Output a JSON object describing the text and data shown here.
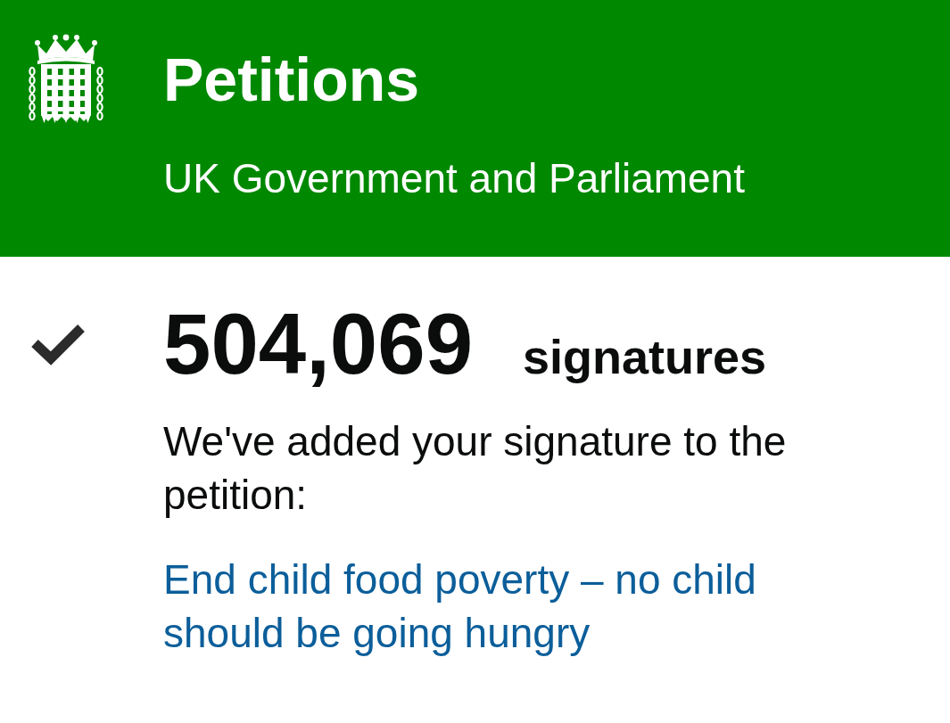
{
  "header": {
    "title": "Petitions",
    "subtitle": "UK Government and Parliament"
  },
  "signature_count": {
    "count": "504,069",
    "unit": "signatures"
  },
  "confirmation": {
    "message": "We've added your signature to the petition:",
    "petition_title": "End child food poverty – no child should be going hungry"
  }
}
